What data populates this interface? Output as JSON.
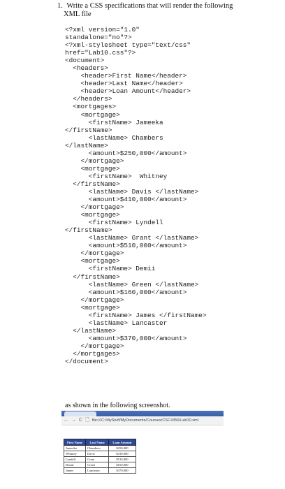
{
  "question": {
    "number": "1.",
    "line1": "Write a CSS specifications that will render the following",
    "line2": "XML file"
  },
  "code_lines": [
    "<?xml version=\"1.0\"",
    "standalone=\"no\"?>",
    "<?xml-stylesheet type=\"text/css\"",
    "href=\"Lab10.css\"?>",
    "<document>",
    "  <headers>",
    "    <header>First Name</header>",
    "    <header>Last Name</header>",
    "    <header>Loan Amount</header>",
    "  </headers>",
    "  <mortgages>",
    "    <mortgage>",
    "      <firstName> Jameeka",
    "</firstName>",
    "      <lastName> Chambers",
    "</lastName>",
    "      <amount>$250,000</amount>",
    "    </mortgage>",
    "    <mortgage>",
    "      <firstName>  Whitney",
    "  </firstName>",
    "      <lastName> Davis </lastName>",
    "      <amount>$410,000</amount>",
    "    </mortgage>",
    "    <mortgage>",
    "      <firstName> Lyndell",
    "</firstName>",
    "      <lastName> Grant </lastName>",
    "      <amount>$510,000</amount>",
    "    </mortgage>",
    "    <mortgage>",
    "      <firstName> Demii",
    "  </firstName>",
    "      <lastName> Green </lastName>",
    "      <amount>$160,000</amount>",
    "    </mortgage>",
    "    <mortgage>",
    "      <firstName> James </firstName>",
    "      <lastName> Lancaster",
    "  </lastName>",
    "      <amount>$370,000</amount>",
    "    </mortgage>",
    "  </mortgages>",
    "</document>"
  ],
  "caption": "as shown in the following screenshot.",
  "browser": {
    "url": "file:///C:/MyStuff/MyDocuments/Courses/CSC4356/Lab10.xml",
    "back_glyph": "←",
    "forward_glyph": "→",
    "reload_glyph": "C",
    "page_glyph": "🗋"
  },
  "table": {
    "headers": [
      "First Name",
      "Last Name",
      "Loan Amount"
    ],
    "rows": [
      [
        "Jameeka",
        "Chambers",
        "$250,000"
      ],
      [
        "Whitney",
        "Davis",
        "$410,000"
      ],
      [
        "Lyndell",
        "Grant",
        "$510,000"
      ],
      [
        "Demii",
        "Green",
        "$160,000"
      ],
      [
        "James",
        "Lancaster",
        "$370,000"
      ]
    ]
  },
  "colors": {
    "table_header_bg": "#2d4a9a",
    "table_header_text": "#ffffff",
    "tabstrip": "#3a5ea8"
  }
}
